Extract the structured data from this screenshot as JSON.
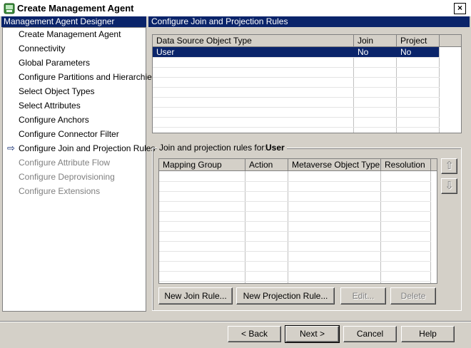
{
  "window": {
    "title": "Create Management Agent",
    "close_glyph": "×"
  },
  "designer": {
    "header": "Management Agent Designer",
    "items": [
      {
        "label": "Create Management Agent",
        "enabled": true
      },
      {
        "label": "Connectivity",
        "enabled": true
      },
      {
        "label": "Global Parameters",
        "enabled": true
      },
      {
        "label": "Configure Partitions and Hierarchies",
        "enabled": true
      },
      {
        "label": "Select Object Types",
        "enabled": true
      },
      {
        "label": "Select Attributes",
        "enabled": true
      },
      {
        "label": "Configure Anchors",
        "enabled": true
      },
      {
        "label": "Configure Connector Filter",
        "enabled": true
      },
      {
        "label": "Configure Join and Projection Rules",
        "enabled": true,
        "current": true
      },
      {
        "label": "Configure Attribute Flow",
        "enabled": false
      },
      {
        "label": "Configure Deprovisioning",
        "enabled": false
      },
      {
        "label": "Configure Extensions",
        "enabled": false
      }
    ],
    "current_marker": "⇨"
  },
  "main": {
    "header": "Configure Join and Projection Rules",
    "ds_table": {
      "columns": [
        "Data Source Object Type",
        "Join",
        "Project"
      ],
      "rows": [
        {
          "type": "User",
          "join": "No",
          "project": "No",
          "selected": true
        }
      ]
    },
    "group": {
      "label": "Join and projection rules for:",
      "value": "User"
    },
    "rules_table": {
      "columns": [
        "Mapping Group",
        "Action",
        "Metaverse Object Type",
        "Resolution"
      ],
      "rows": []
    },
    "buttons": {
      "new_join": "New Join Rule...",
      "new_projection": "New Projection Rule...",
      "edit": "Edit...",
      "delete": "Delete",
      "move_up_glyph": "⇧",
      "move_down_glyph": "⇩"
    }
  },
  "footer": {
    "back": "< Back",
    "next": "Next >",
    "cancel": "Cancel",
    "help": "Help"
  },
  "colors": {
    "selection": "#0a246a",
    "face": "#d4d0c8",
    "disabled_text": "#808080"
  }
}
